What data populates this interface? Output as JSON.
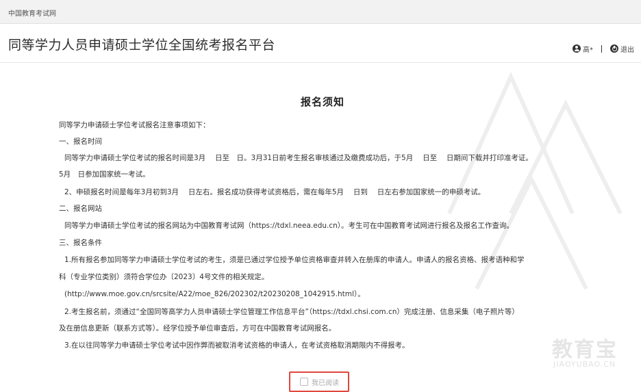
{
  "topbar": {
    "site_link": "中国教育考试网"
  },
  "header": {
    "title": "同等学力人员申请硕士学位全国统考报名平台",
    "user_name": "高*",
    "logout_label": "退出"
  },
  "notice": {
    "title": "报名须知",
    "lines": [
      "同等学力申请硕士学位考试报名注意事项如下：",
      "一、报名时间",
      "同等学力申请硕士学位考试的报名时间是3月　 日至　日。3月31日前考生报名审核通过及缴费成功后，于5月　 日至　 日期间下载并打印准考证。",
      "5月　日参加国家统一考试。",
      "2、申硕报名时间是每年3月初到3月　 日左右。报名成功获得考试资格后，需在每年5月　 日到　 日左右参加国家统一的申硕考试。",
      "二、报名网站",
      "同等学力申请硕士学位考试的报名网站为中国教育考试网（https://tdxl.neea.edu.cn）。考生可在中国教育考试网进行报名及报名工作查询。",
      "三、报名条件",
      "1.所有报名参加同等学力申请硕士学位考试的考生，须是已通过学位授予单位资格审查并转入在册库的申请人。申请人的报名资格、报考语种和学",
      "科（专业学位类别）须符合学位办〔2023〕4号文件的相关规定。",
      "(http://www.moe.gov.cn/srcsite/A22/moe_826/202302/t20230208_1042915.html）。",
      "2.考生报名前，须通过“全国同等高学力人员申请硕士学位管理工作信息平台”（https://tdxl.chsi.com.cn）完成注册、信息采集（电子照片等）",
      "及在册信息更新（联系方式等）。经学位授予单位审查后，方可在中国教育考试网报名。",
      "3.在以往同等学力申请硕士学位考试中因作弊而被取消考试资格的申请人，在考试资格取消期限内不得报考。"
    ],
    "agree_label": "我已阅读"
  },
  "watermark": {
    "cn": "教育宝",
    "en": "JIAOYUBAO.CN"
  },
  "colors": {
    "highlight_border": "#e0463c"
  }
}
